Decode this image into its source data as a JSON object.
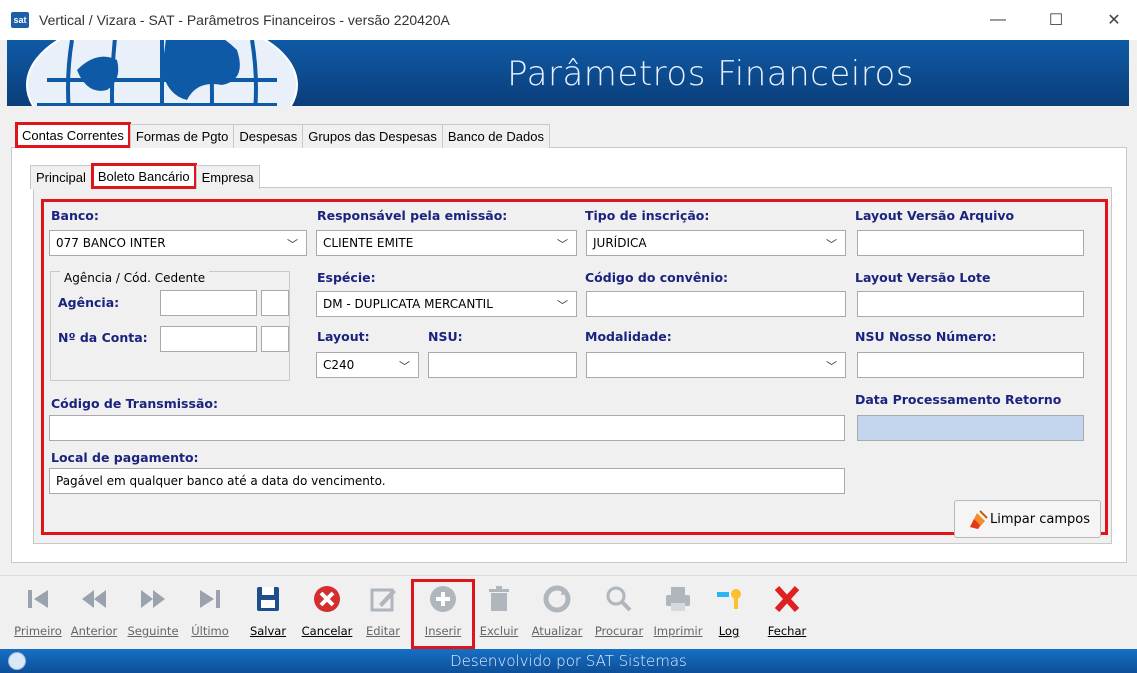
{
  "window": {
    "icon_label": "sat",
    "title": "Vertical / Vizara - SAT - Parâmetros Financeiros - versão 220420A",
    "minimize_glyph": "—",
    "maximize_glyph": "☐",
    "close_glyph": "✕"
  },
  "banner": {
    "title": "Parâmetros Financeiros"
  },
  "main_tabs": [
    "Contas Correntes",
    "Formas de Pgto",
    "Despesas",
    "Grupos das Despesas",
    "Banco de Dados"
  ],
  "sub_tabs": [
    "Principal",
    "Boleto Bancário",
    "Empresa"
  ],
  "form": {
    "banco_label": "Banco:",
    "banco_value": "077 BANCO INTER",
    "responsavel_label": "Responsável pela emissão:",
    "responsavel_value": "CLIENTE EMITE",
    "tipo_label": "Tipo de inscrição:",
    "tipo_value": "JURÍDICA",
    "layout_arquivo_label": "Layout Versão Arquivo",
    "layout_arquivo_value": "",
    "agencia_group_title": "Agência / Cód. Cedente",
    "agencia_label": "Agência:",
    "agencia_value": "",
    "agencia_dv_value": "",
    "conta_label": "Nº da Conta:",
    "conta_value": "",
    "conta_dv_value": "",
    "especie_label": "Espécie:",
    "especie_value": "DM - DUPLICATA MERCANTIL",
    "convenio_label": "Código do convênio:",
    "convenio_value": "",
    "layout_lote_label": "Layout Versão Lote",
    "layout_lote_value": "",
    "layout_label": "Layout:",
    "layout_value": "C240",
    "nsu_label": "NSU:",
    "nsu_value": "",
    "modalidade_label": "Modalidade:",
    "modalidade_value": "",
    "nsu_nosso_label": "NSU Nosso Número:",
    "nsu_nosso_value": "",
    "transmissao_label": "Código de Transmissão:",
    "transmissao_value": "",
    "data_proc_label": "Data Processamento Retorno",
    "data_proc_value": "",
    "local_label": "Local de pagamento:",
    "local_value": "Pagável em qualquer banco até a data do vencimento.",
    "limpar_label": "Limpar campos"
  },
  "toolbar": {
    "primeiro": "Primeiro",
    "anterior": "Anterior",
    "seguinte": "Seguinte",
    "ultimo": "Último",
    "salvar": "Salvar",
    "cancelar": "Cancelar",
    "editar": "Editar",
    "inserir": "Inserir",
    "excluir": "Excluir",
    "atualizar": "Atualizar",
    "procurar": "Procurar",
    "imprimir": "Imprimir",
    "log": "Log",
    "fechar": "Fechar"
  },
  "status": {
    "text": "Desenvolvido por SAT Sistemas"
  },
  "colors": {
    "highlight": "#e0151b",
    "label_blue": "#1a237e",
    "banner_blue": "#0f5aa6"
  }
}
